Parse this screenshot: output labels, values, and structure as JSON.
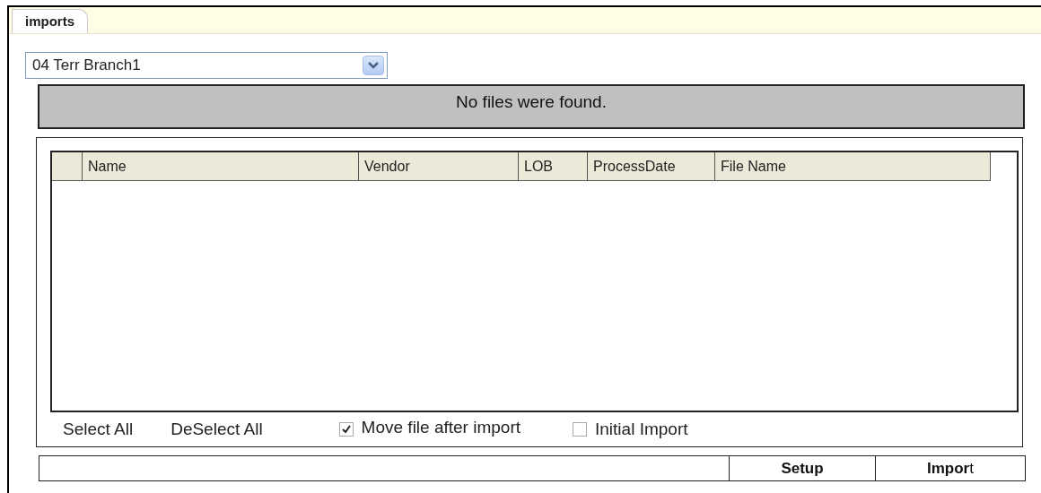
{
  "tabs": [
    {
      "label": "imports",
      "selected": true
    }
  ],
  "branch_select": {
    "value": "04 Terr Branch1"
  },
  "message": "No files were found.",
  "table": {
    "columns": [
      "Name",
      "Vendor",
      "LOB",
      "ProcessDate",
      "File Name"
    ]
  },
  "links": [
    "Select All",
    "DeSelect All"
  ],
  "options": [
    {
      "label": "Move file after import",
      "checked": true
    },
    {
      "label": "Initial Import",
      "checked": false
    }
  ],
  "buttons": [
    "Setup",
    "**Impor**t"
  ]
}
